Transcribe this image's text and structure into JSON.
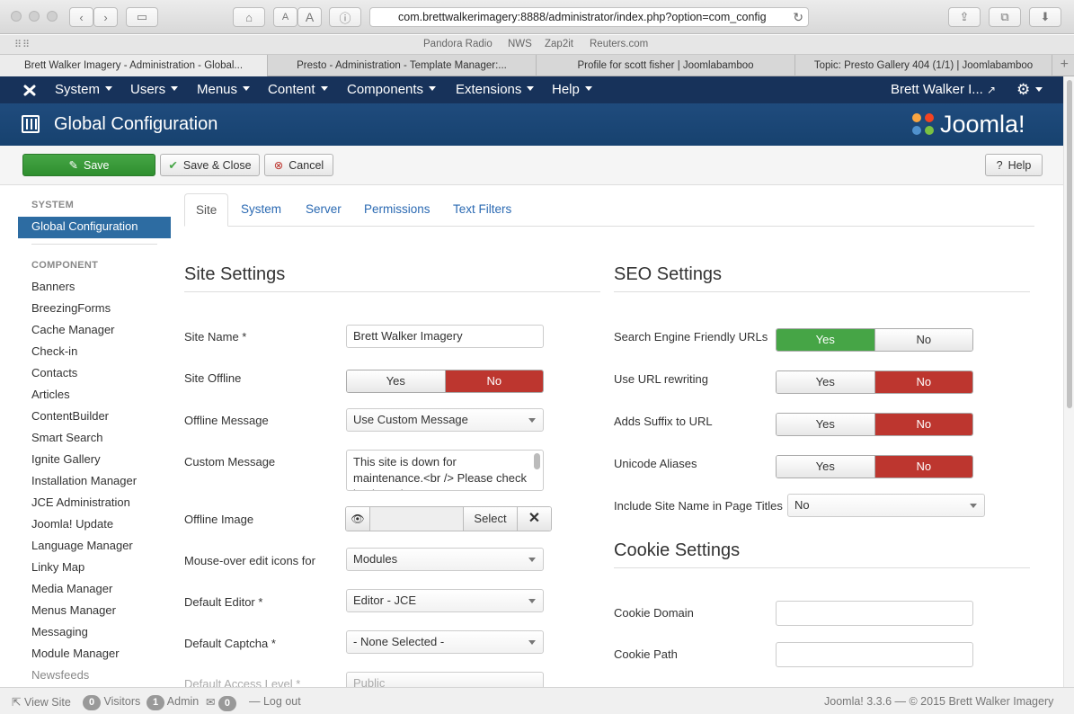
{
  "browser": {
    "url": "com.brettwalkerimagery:8888/administrator/index.php?option=com_config",
    "bookmarks": [
      "Pandora Radio",
      "NWS",
      "Zap2it",
      "Reuters.com"
    ],
    "tabs": [
      "Brett Walker Imagery - Administration - Global...",
      "Presto - Administration - Template Manager:...",
      "Profile for scott fisher | Joomlabamboo",
      "Topic: Presto Gallery 404 (1/1) | Joomlabamboo"
    ]
  },
  "navbar": {
    "menus": [
      "System",
      "Users",
      "Menus",
      "Content",
      "Components",
      "Extensions",
      "Help"
    ],
    "user": "Brett Walker I..."
  },
  "header": {
    "title": "Global Configuration",
    "logo_text": "Joomla!"
  },
  "toolbar": {
    "save": "Save",
    "save_close": "Save & Close",
    "cancel": "Cancel",
    "help": "Help"
  },
  "sidebar": {
    "system_heading": "SYSTEM",
    "active": "Global Configuration",
    "component_heading": "COMPONENT",
    "items": [
      "Banners",
      "BreezingForms",
      "Cache Manager",
      "Check-in",
      "Contacts",
      "Articles",
      "ContentBuilder",
      "Smart Search",
      "Ignite Gallery",
      "Installation Manager",
      "JCE Administration",
      "Joomla! Update",
      "Language Manager",
      "Linky Map",
      "Media Manager",
      "Menus Manager",
      "Messaging",
      "Module Manager",
      "Newsfeeds"
    ]
  },
  "tabs": [
    "Site",
    "System",
    "Server",
    "Permissions",
    "Text Filters"
  ],
  "site": {
    "heading": "Site Settings",
    "site_name_label": "Site Name *",
    "site_name": "Brett Walker Imagery",
    "offline_label": "Site Offline",
    "offline_message_label": "Offline Message",
    "offline_message": "Use Custom Message",
    "custom_message_label": "Custom Message",
    "custom_message": "This site is down for maintenance.<br /> Please check back again soon.",
    "offline_image_label": "Offline Image",
    "select": "Select",
    "mouseover_label": "Mouse-over edit icons for",
    "mouseover": "Modules",
    "editor_label": "Default Editor *",
    "editor": "Editor - JCE",
    "captcha_label": "Default Captcha *",
    "captcha": "- None Selected -",
    "access_label": "Default Access Level *",
    "access": "Public"
  },
  "yes": "Yes",
  "no": "No",
  "seo": {
    "heading": "SEO Settings",
    "sef_label": "Search Engine Friendly URLs",
    "rewrite_label": "Use URL rewriting",
    "suffix_label": "Adds Suffix to URL",
    "unicode_label": "Unicode Aliases",
    "sitename_label": "Include Site Name in Page Titles",
    "sitename": "No"
  },
  "cookie": {
    "heading": "Cookie Settings",
    "domain_label": "Cookie Domain",
    "path_label": "Cookie Path"
  },
  "footer": {
    "view_site": "View Site",
    "visitors_count": "0",
    "visitors": "Visitors",
    "admin_count": "1",
    "admin": "Admin",
    "messages_count": "0",
    "logout": "Log out",
    "copyright": "Joomla! 3.3.6  —  © 2015 Brett Walker Imagery"
  },
  "colors": {
    "navbar": "#17325a",
    "header": "#1f4b7d",
    "accent": "#2d6ca2",
    "green": "#46a546",
    "red": "#bd362f"
  }
}
